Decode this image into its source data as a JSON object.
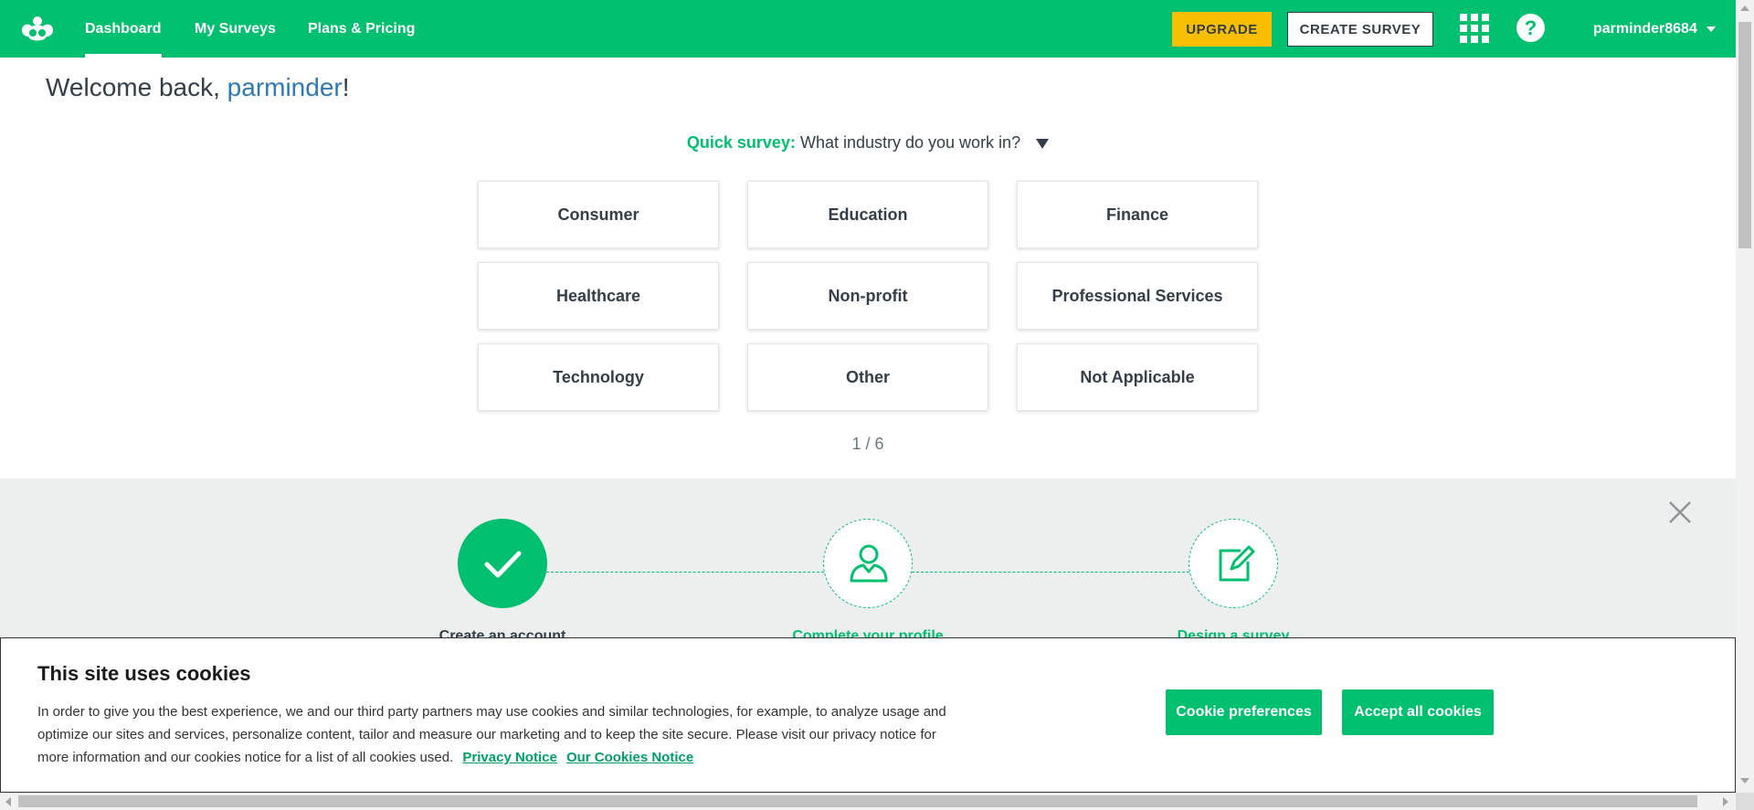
{
  "nav": {
    "logo_icon": "surveymonkey-logo-icon",
    "links": [
      {
        "label": "Dashboard",
        "active": true
      },
      {
        "label": "My Surveys",
        "active": false
      },
      {
        "label": "Plans & Pricing",
        "active": false
      }
    ],
    "upgrade_label": "UPGRADE",
    "create_label": "CREATE SURVEY",
    "apps_icon": "apps-grid-icon",
    "help_icon": "help-icon",
    "help_glyph": "?",
    "username": "parminder8684",
    "colors": {
      "brand": "#00bf6f",
      "upgrade": "#f9be00"
    }
  },
  "welcome": {
    "prefix": "Welcome back, ",
    "name": "parminder",
    "suffix": "!"
  },
  "quick_survey": {
    "label": "Quick survey:",
    "question": "What industry do you work in?",
    "options": [
      "Consumer",
      "Education",
      "Finance",
      "Healthcare",
      "Non-profit",
      "Professional Services",
      "Technology",
      "Other",
      "Not Applicable"
    ],
    "pager": "1 / 6"
  },
  "onboarding": {
    "close_icon": "close-icon",
    "steps": [
      {
        "label": "Create an account",
        "icon": "check-icon",
        "done": true
      },
      {
        "label": "Complete your profile",
        "icon": "user-icon",
        "done": false
      },
      {
        "label": "Design a survey",
        "icon": "edit-icon",
        "done": false
      }
    ]
  },
  "cookie_banner": {
    "title": "This site uses cookies",
    "text": "In order to give you the best experience, we and our third party partners may use cookies and similar technologies, for example, to analyze usage and optimize our sites and services, personalize content, tailor and measure our marketing and to keep the site secure. Please visit our privacy notice for more information and our cookies notice for a list of all cookies used.",
    "privacy_link": "Privacy Notice",
    "cookies_link": "Our Cookies Notice",
    "preferences_label": "Cookie preferences",
    "accept_label": "Accept all cookies"
  }
}
